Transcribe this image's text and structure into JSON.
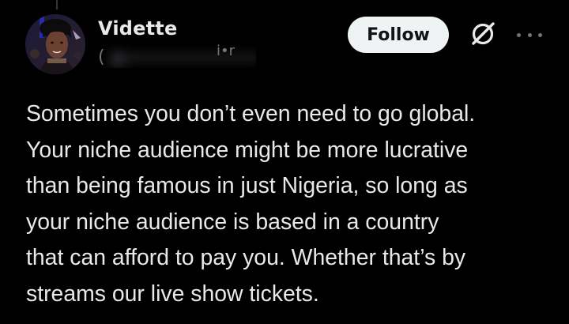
{
  "author": {
    "display_name": "Vidette",
    "handle_redacted": "@•••••••••••••",
    "handle_visible_fragment_left": "(",
    "handle_visible_fragment_right": "i•r"
  },
  "actions": {
    "follow_label": "Follow"
  },
  "icons": {
    "grok": "grok-icon",
    "more": "more-icon"
  },
  "tweet": {
    "lines": [
      "Sometimes you don’t even need to go global.",
      "Your niche audience might be more lucrative",
      "than being famous in just Nigeria, so long as",
      "your niche audience is based in a country",
      "that can afford to pay you. Whether that’s by",
      "streams our live show tickets."
    ]
  },
  "colors": {
    "background": "#000000",
    "text_primary": "#e7e9ea",
    "text_secondary": "#71767b",
    "follow_bg": "#eff3f4",
    "follow_text": "#0f1419"
  }
}
